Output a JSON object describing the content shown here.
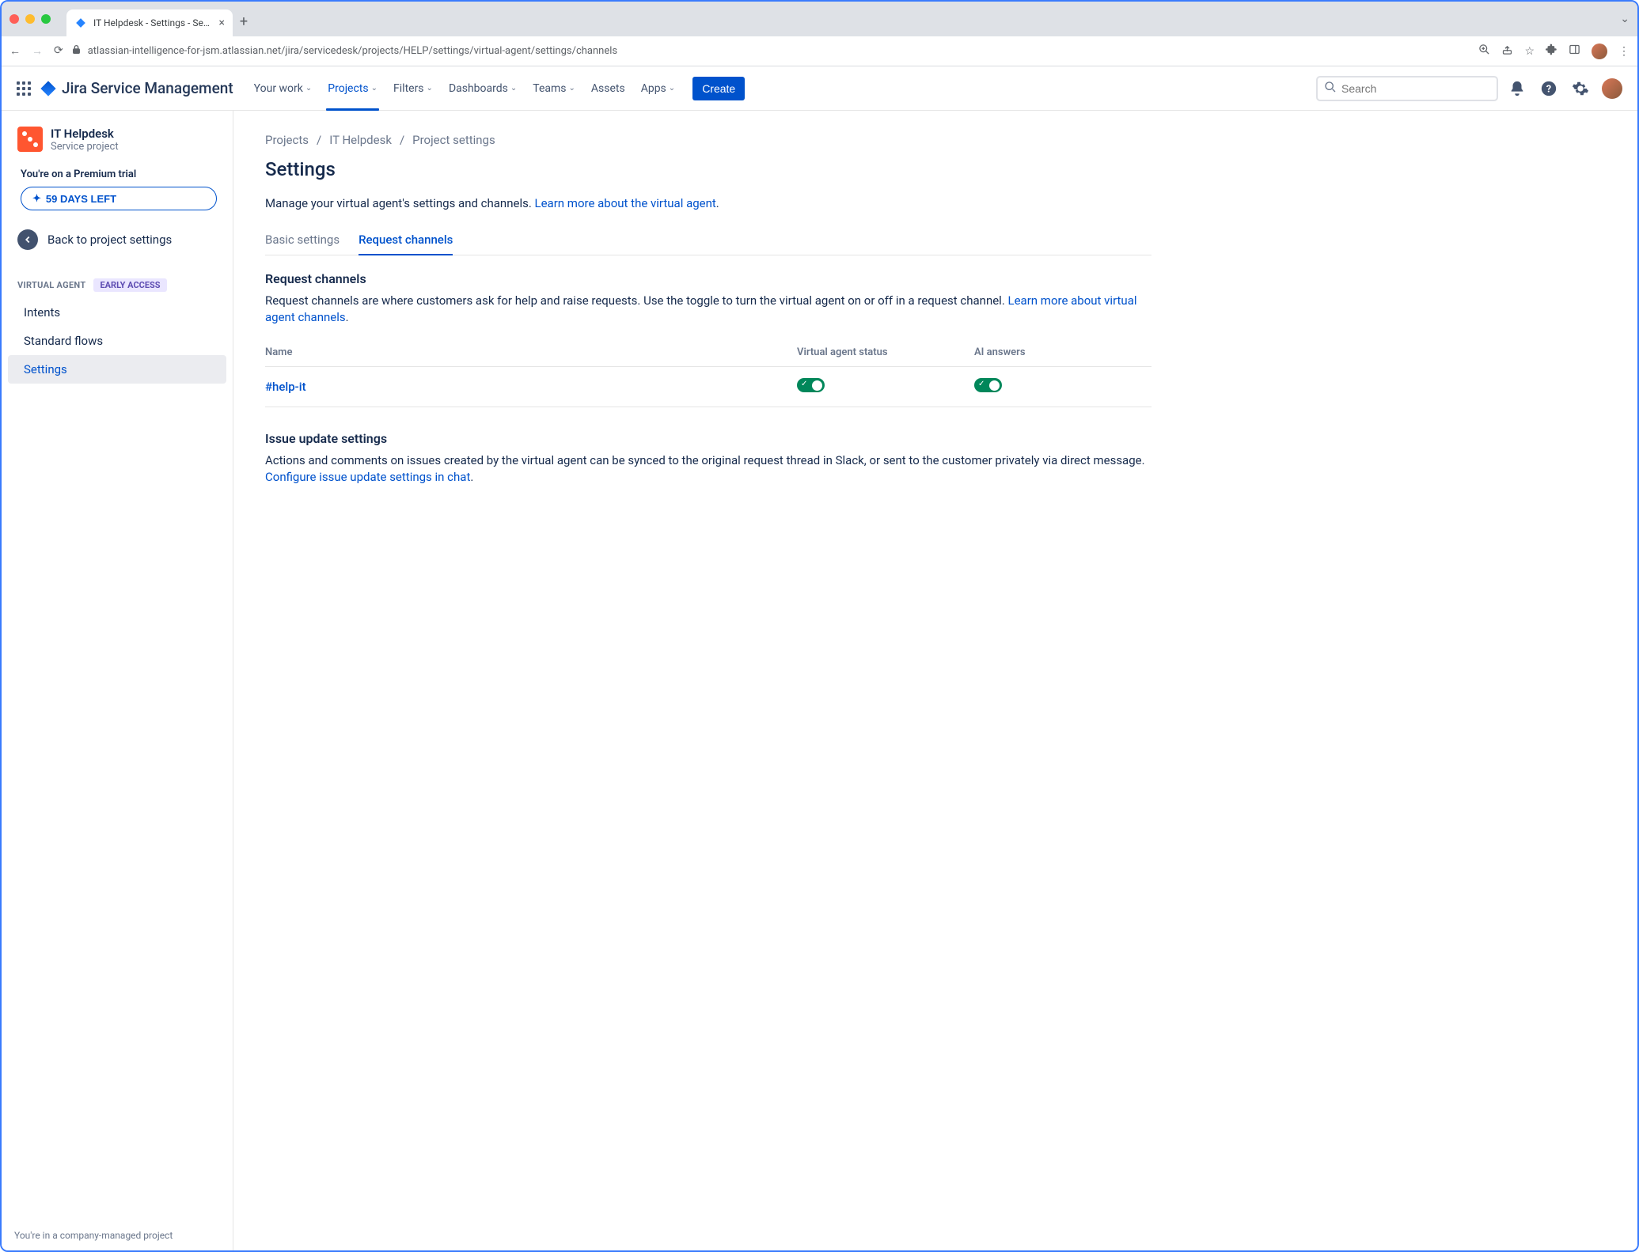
{
  "browser": {
    "tab_title": "IT Helpdesk - Settings - Servic",
    "url": "atlassian-intelligence-for-jsm.atlassian.net/jira/servicedesk/projects/HELP/settings/virtual-agent/settings/channels"
  },
  "topnav": {
    "brand": "Jira Service Management",
    "items": [
      "Your work",
      "Projects",
      "Filters",
      "Dashboards",
      "Teams",
      "Assets",
      "Apps"
    ],
    "active_index": 1,
    "create": "Create",
    "search_placeholder": "Search"
  },
  "sidebar": {
    "project_name": "IT Helpdesk",
    "project_type": "Service project",
    "trial_text": "You're on a Premium trial",
    "trial_button": "59 DAYS LEFT",
    "back_label": "Back to project settings",
    "section_label": "VIRTUAL AGENT",
    "badge": "EARLY ACCESS",
    "items": [
      "Intents",
      "Standard flows",
      "Settings"
    ],
    "active_index": 2,
    "footer": "You're in a company-managed project"
  },
  "breadcrumb": [
    "Projects",
    "IT Helpdesk",
    "Project settings"
  ],
  "page": {
    "title": "Settings",
    "description": "Manage your virtual agent's settings and channels. ",
    "description_link": "Learn more about the virtual agent",
    "tabs": [
      "Basic settings",
      "Request channels"
    ],
    "active_tab": 1,
    "channels": {
      "heading": "Request channels",
      "desc": "Request channels are where customers ask for help and raise requests. Use the toggle to turn the virtual agent on or off in a request channel. ",
      "desc_link": "Learn more about virtual agent channels",
      "columns": [
        "Name",
        "Virtual agent status",
        "AI answers"
      ],
      "rows": [
        {
          "name": "#help-it",
          "va_status": true,
          "ai_answers": true
        }
      ]
    },
    "issue": {
      "heading": "Issue update settings",
      "desc": "Actions and comments on issues created by the virtual agent can be synced to the original request thread in Slack, or sent to the customer privately via direct message. ",
      "desc_link": "Configure issue update settings in chat"
    }
  }
}
